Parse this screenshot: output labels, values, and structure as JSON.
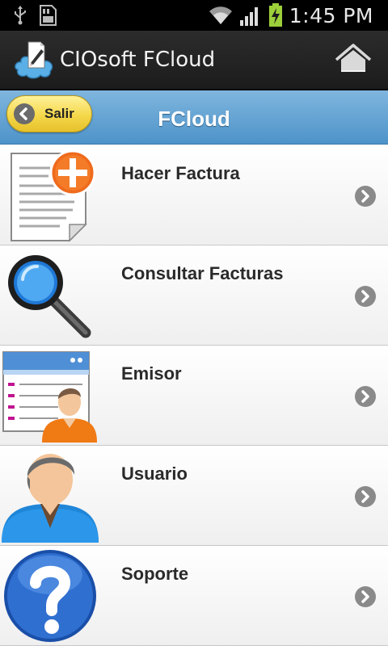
{
  "status_bar": {
    "time": "1:45 PM",
    "icons": [
      "usb-icon",
      "sd-card-icon",
      "wifi-icon",
      "signal-icon",
      "battery-charging-icon"
    ]
  },
  "action_bar": {
    "title": "CIOsoft FCloud",
    "icons": [
      "app-cloud-icon",
      "home-icon"
    ]
  },
  "header": {
    "back_label": "Salir",
    "title": "FCloud"
  },
  "menu": {
    "items": [
      {
        "label": "Hacer Factura",
        "icon": "new-invoice-icon"
      },
      {
        "label": "Consultar Facturas",
        "icon": "magnifier-icon"
      },
      {
        "label": "Emisor",
        "icon": "issuer-card-icon"
      },
      {
        "label": "Usuario",
        "icon": "user-icon"
      },
      {
        "label": "Soporte",
        "icon": "help-icon"
      }
    ]
  },
  "colors": {
    "header_blue": "#5c9fd2",
    "back_button_yellow": "#f4d74a",
    "action_bar": "#222222"
  }
}
